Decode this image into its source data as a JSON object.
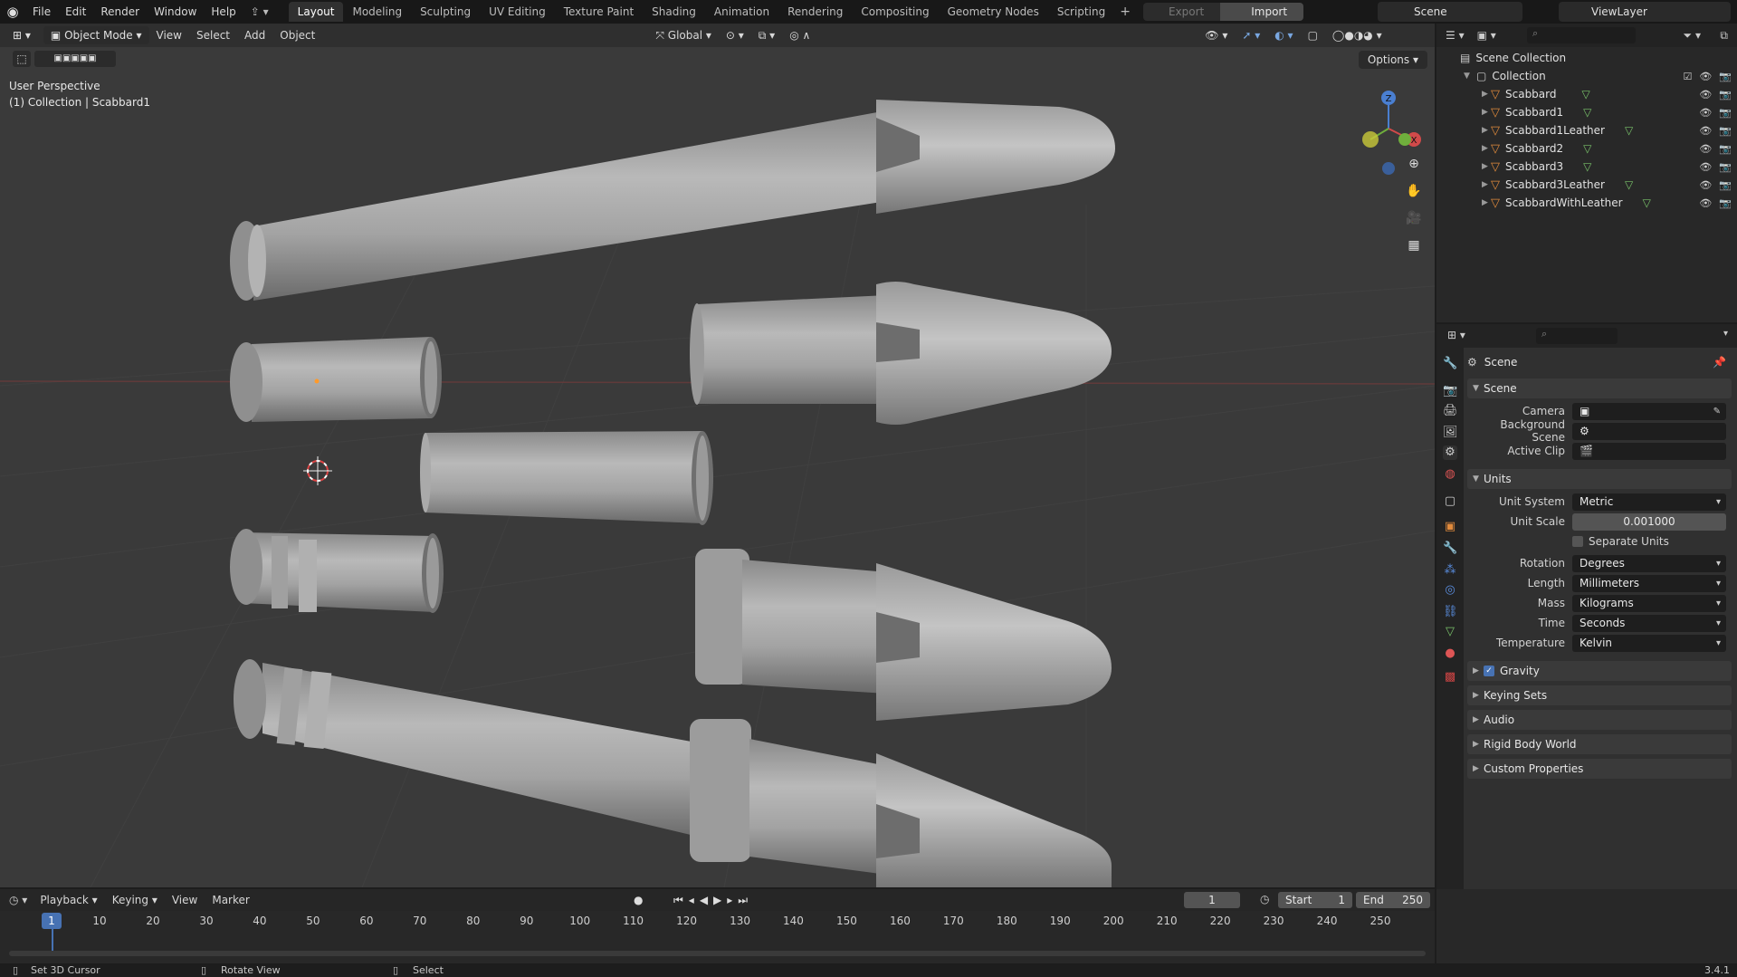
{
  "topbar": {
    "menus": [
      "File",
      "Edit",
      "Render",
      "Window",
      "Help"
    ],
    "workspaces": [
      "Layout",
      "Modeling",
      "Sculpting",
      "UV Editing",
      "Texture Paint",
      "Shading",
      "Animation",
      "Rendering",
      "Compositing",
      "Geometry Nodes",
      "Scripting"
    ],
    "active_workspace": "Layout",
    "export_label": "Export",
    "import_label": "Import",
    "scene": "Scene",
    "view_layer": "ViewLayer"
  },
  "viewport": {
    "mode": "Object Mode",
    "menus": [
      "View",
      "Select",
      "Add",
      "Object"
    ],
    "transform_orientation": "Global",
    "options_label": "Options",
    "info_line1": "User Perspective",
    "info_line2": "(1) Collection | Scabbard1",
    "gizmo_axes": [
      "Z",
      "X"
    ]
  },
  "outliner": {
    "root": "Scene Collection",
    "collection": "Collection",
    "objects": [
      "Scabbard",
      "Scabbard1",
      "Scabbard1Leather",
      "Scabbard2",
      "Scabbard3",
      "Scabbard3Leather",
      "ScabbardWithLeather"
    ]
  },
  "properties": {
    "context": "Scene",
    "scene_panel": "Scene",
    "camera_label": "Camera",
    "bg_scene_label": "Background Scene",
    "active_clip_label": "Active Clip",
    "units_panel": "Units",
    "unit_system_label": "Unit System",
    "unit_system": "Metric",
    "unit_scale_label": "Unit Scale",
    "unit_scale": "0.001000",
    "separate_units": "Separate Units",
    "rotation_label": "Rotation",
    "rotation": "Degrees",
    "length_label": "Length",
    "length": "Millimeters",
    "mass_label": "Mass",
    "mass": "Kilograms",
    "time_label": "Time",
    "time": "Seconds",
    "temperature_label": "Temperature",
    "temperature": "Kelvin",
    "gravity": "Gravity",
    "keying_sets": "Keying Sets",
    "audio": "Audio",
    "rigid_body_world": "Rigid Body World",
    "custom_properties": "Custom Properties"
  },
  "timeline": {
    "menus": [
      "Playback",
      "Keying",
      "View",
      "Marker"
    ],
    "current_frame": "1",
    "start_label": "Start",
    "start": "1",
    "end_label": "End",
    "end": "250",
    "ticks": [
      "1",
      "10",
      "20",
      "30",
      "40",
      "50",
      "60",
      "70",
      "80",
      "90",
      "100",
      "110",
      "120",
      "130",
      "140",
      "150",
      "160",
      "170",
      "180",
      "190",
      "200",
      "210",
      "220",
      "230",
      "240",
      "250"
    ]
  },
  "statusbar": {
    "left": "Set 3D Cursor",
    "middle": "Rotate View",
    "right": "Select",
    "version": "3.4.1"
  }
}
